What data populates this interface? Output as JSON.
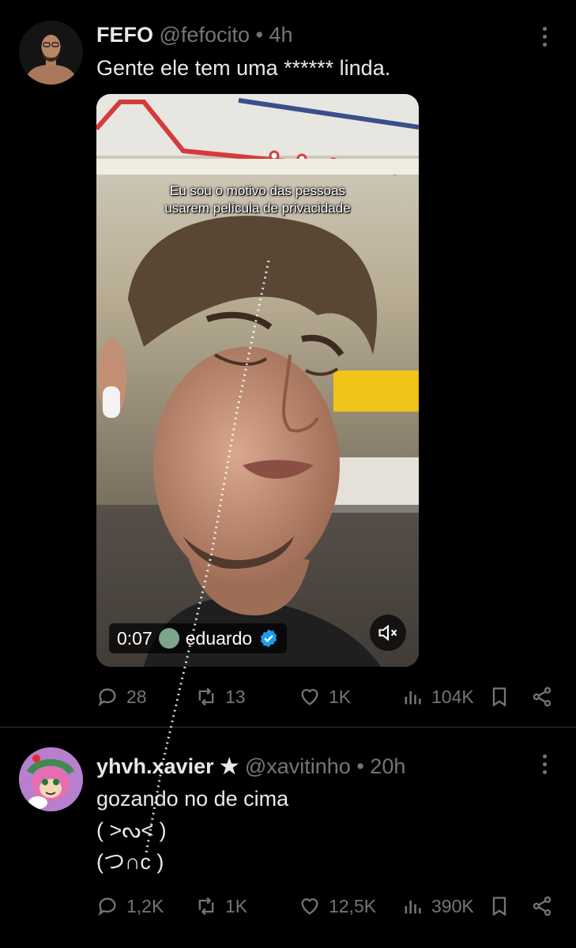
{
  "tweet1": {
    "name": "FEFO",
    "handle": "@fefocito",
    "sep": "•",
    "time": "4h",
    "text": "Gente ele tem uma ****** linda.",
    "video": {
      "caption_line1": "Eu sou o motivo das pessoas",
      "caption_line2": "usarem película de privacidade",
      "duration": "0:07",
      "author": "eduardo"
    },
    "actions": {
      "replies": "28",
      "retweets": "13",
      "likes": "1K",
      "views": "104K"
    }
  },
  "tweet2": {
    "name": "yhvh.xavier ★",
    "handle": "@xavitinho",
    "sep": "•",
    "time": "20h",
    "text_line1": "gozando no de cima",
    "text_line2": "( ˃ᔓ˂ )",
    "text_line3": "(つ∩c )",
    "actions": {
      "replies": "1,2K",
      "retweets": "1K",
      "likes": "12,5K",
      "views": "390K"
    }
  },
  "colors": {
    "background": "#000000",
    "text": "#e7e9ea",
    "muted": "#71767b",
    "divider": "#2f3336",
    "verified": "#1d9bf0"
  }
}
